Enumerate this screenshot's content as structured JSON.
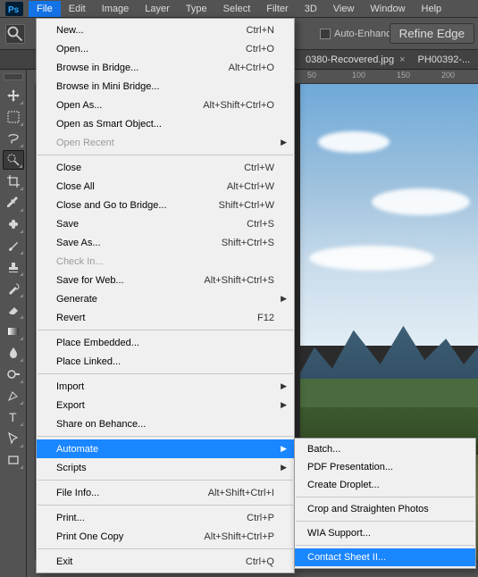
{
  "menubar": {
    "items": [
      "File",
      "Edit",
      "Image",
      "Layer",
      "Type",
      "Select",
      "Filter",
      "3D",
      "View",
      "Window",
      "Help"
    ],
    "open_index": 0
  },
  "optionbar": {
    "auto_enhance_label": "Auto-Enhance",
    "refine_label": "Refine Edge"
  },
  "tabs": [
    {
      "label": "0380-Recovered.jpg",
      "close": "×"
    },
    {
      "label": "PH00392-...",
      "close": ""
    }
  ],
  "ruler": {
    "ticks": [
      "50",
      "100",
      "150",
      "200"
    ]
  },
  "file_menu": [
    {
      "type": "item",
      "label": "New...",
      "shortcut": "Ctrl+N"
    },
    {
      "type": "item",
      "label": "Open...",
      "shortcut": "Ctrl+O"
    },
    {
      "type": "item",
      "label": "Browse in Bridge...",
      "shortcut": "Alt+Ctrl+O"
    },
    {
      "type": "item",
      "label": "Browse in Mini Bridge..."
    },
    {
      "type": "item",
      "label": "Open As...",
      "shortcut": "Alt+Shift+Ctrl+O"
    },
    {
      "type": "item",
      "label": "Open as Smart Object..."
    },
    {
      "type": "item",
      "label": "Open Recent",
      "submenu": true,
      "disabled": true
    },
    {
      "type": "sep"
    },
    {
      "type": "item",
      "label": "Close",
      "shortcut": "Ctrl+W"
    },
    {
      "type": "item",
      "label": "Close All",
      "shortcut": "Alt+Ctrl+W"
    },
    {
      "type": "item",
      "label": "Close and Go to Bridge...",
      "shortcut": "Shift+Ctrl+W"
    },
    {
      "type": "item",
      "label": "Save",
      "shortcut": "Ctrl+S"
    },
    {
      "type": "item",
      "label": "Save As...",
      "shortcut": "Shift+Ctrl+S"
    },
    {
      "type": "item",
      "label": "Check In...",
      "disabled": true
    },
    {
      "type": "item",
      "label": "Save for Web...",
      "shortcut": "Alt+Shift+Ctrl+S"
    },
    {
      "type": "item",
      "label": "Generate",
      "submenu": true
    },
    {
      "type": "item",
      "label": "Revert",
      "shortcut": "F12"
    },
    {
      "type": "sep"
    },
    {
      "type": "item",
      "label": "Place Embedded..."
    },
    {
      "type": "item",
      "label": "Place Linked..."
    },
    {
      "type": "sep"
    },
    {
      "type": "item",
      "label": "Import",
      "submenu": true
    },
    {
      "type": "item",
      "label": "Export",
      "submenu": true
    },
    {
      "type": "item",
      "label": "Share on Behance..."
    },
    {
      "type": "sep"
    },
    {
      "type": "item",
      "label": "Automate",
      "submenu": true,
      "highlight": true
    },
    {
      "type": "item",
      "label": "Scripts",
      "submenu": true
    },
    {
      "type": "sep"
    },
    {
      "type": "item",
      "label": "File Info...",
      "shortcut": "Alt+Shift+Ctrl+I"
    },
    {
      "type": "sep"
    },
    {
      "type": "item",
      "label": "Print...",
      "shortcut": "Ctrl+P"
    },
    {
      "type": "item",
      "label": "Print One Copy",
      "shortcut": "Alt+Shift+Ctrl+P"
    },
    {
      "type": "sep"
    },
    {
      "type": "item",
      "label": "Exit",
      "shortcut": "Ctrl+Q"
    }
  ],
  "automate_submenu": [
    {
      "type": "item",
      "label": "Batch..."
    },
    {
      "type": "item",
      "label": "PDF Presentation..."
    },
    {
      "type": "item",
      "label": "Create Droplet..."
    },
    {
      "type": "sep"
    },
    {
      "type": "item",
      "label": "Crop and Straighten Photos"
    },
    {
      "type": "sep"
    },
    {
      "type": "item",
      "label": "WIA Support..."
    },
    {
      "type": "sep"
    },
    {
      "type": "item",
      "label": "Contact Sheet II...",
      "highlight": true
    }
  ],
  "tools": [
    "move-tool",
    "marquee-tool",
    "lasso-tool",
    "quick-select-tool",
    "crop-tool",
    "eyedropper-tool",
    "healing-tool",
    "brush-tool",
    "stamp-tool",
    "history-brush-tool",
    "eraser-tool",
    "gradient-tool",
    "blur-tool",
    "dodge-tool",
    "pen-tool",
    "type-tool",
    "path-select-tool",
    "rectangle-tool"
  ],
  "selected_tool_index": 3
}
